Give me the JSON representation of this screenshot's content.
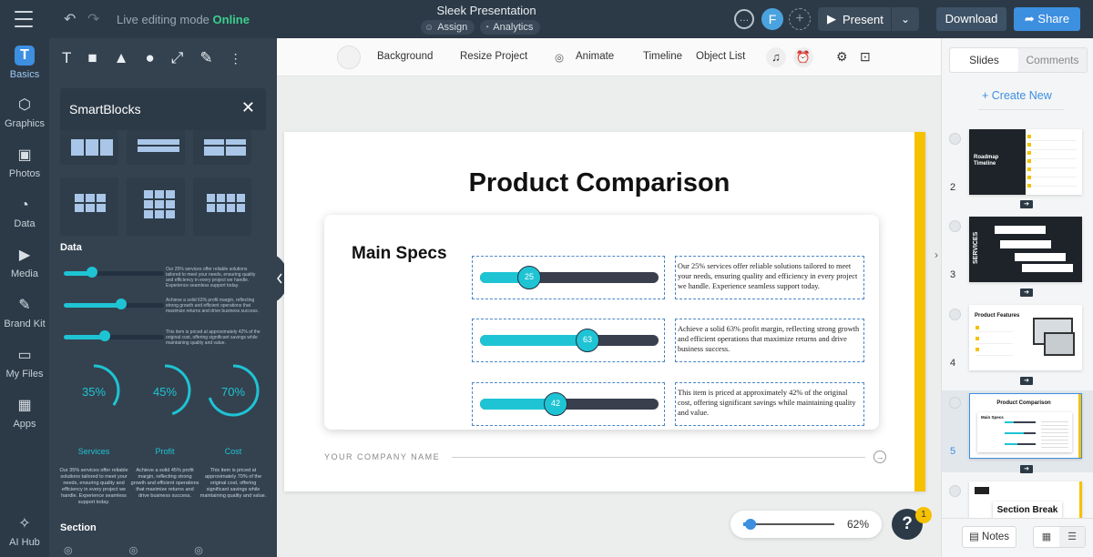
{
  "topbar": {
    "mode_label": "Live editing mode",
    "mode_status": "Online",
    "title": "Sleek Presentation",
    "assign_label": "Assign",
    "analytics_label": "Analytics",
    "avatar_initial": "F",
    "present_label": "Present",
    "download_label": "Download",
    "share_label": "Share"
  },
  "rail": {
    "items": [
      {
        "label": "Basics",
        "icon": "T"
      },
      {
        "label": "Graphics",
        "icon": "shapes-icon"
      },
      {
        "label": "Photos",
        "icon": "photo-icon"
      },
      {
        "label": "Data",
        "icon": "pie-icon"
      },
      {
        "label": "Media",
        "icon": "media-icon"
      },
      {
        "label": "Brand Kit",
        "icon": "brand-icon"
      },
      {
        "label": "My Files",
        "icon": "folder-icon"
      },
      {
        "label": "Apps",
        "icon": "apps-icon"
      },
      {
        "label": "AI Hub",
        "icon": "sparkle-icon"
      }
    ]
  },
  "panel": {
    "smartblocks_title": "SmartBlocks",
    "data_section": "Data",
    "section_section": "Section",
    "slider_texts": [
      "Our 25% services offer reliable solutions tailored to meet your needs, ensuring quality and efficiency in every project we handle. Experience seamless support today.",
      "Achieve a solid 63% profit margin, reflecting strong growth and efficient operations that maximize returns and drive business success.",
      "This item is priced at approximately 42% of the original cost, offering significant savings while maintaining quality and value."
    ],
    "donuts": [
      {
        "value": "35%",
        "caption": "Services",
        "desc": "Our 35% services offer reliable solutions tailored to meet your needs, ensuring quality and efficiency in every project we handle. Experience seamless support today."
      },
      {
        "value": "45%",
        "caption": "Profit",
        "desc": "Achieve a solid 45% profit margin, reflecting strong growth and efficient operations that maximize returns and drive business success."
      },
      {
        "value": "70%",
        "caption": "Cost",
        "desc": "This item is priced at approximately 70% of the original cost, offering significant savings while maintaining quality and value."
      }
    ]
  },
  "canvas_toolbar": {
    "background": "Background",
    "resize": "Resize Project",
    "animate": "Animate",
    "timeline": "Timeline",
    "object_list": "Object List"
  },
  "slide": {
    "title": "Product Comparison",
    "card_title": "Main Specs",
    "rows": [
      {
        "value": "25",
        "text": "Our 25% services offer reliable solutions tailored to meet your needs, ensuring quality and efficiency in every project we handle. Experience seamless support today."
      },
      {
        "value": "63",
        "text": "Achieve a solid 63% profit margin, reflecting strong growth and efficient operations that maximize returns and drive business success."
      },
      {
        "value": "42",
        "text": "This item is priced at approximately 42% of the original cost, offering significant savings while maintaining quality and value."
      }
    ],
    "company": "YOUR COMPANY NAME",
    "accent": "#f5c100",
    "bar_color": "#1ec4d4"
  },
  "zoom": {
    "percent": "62%",
    "level": 0.14
  },
  "help": {
    "label": "?",
    "badge": "1"
  },
  "right_panel": {
    "tab_slides": "Slides",
    "tab_comments": "Comments",
    "create_new": "+ Create New",
    "thumbs": [
      {
        "num": "2",
        "title": "Roadmap Timeline"
      },
      {
        "num": "3",
        "title": "SERVICES"
      },
      {
        "num": "4",
        "title": "Product Features"
      },
      {
        "num": "5",
        "title": "Product Comparison",
        "sub": "Main Specs"
      },
      {
        "num": "",
        "title": "Section Break"
      }
    ],
    "notes_label": "Notes"
  }
}
